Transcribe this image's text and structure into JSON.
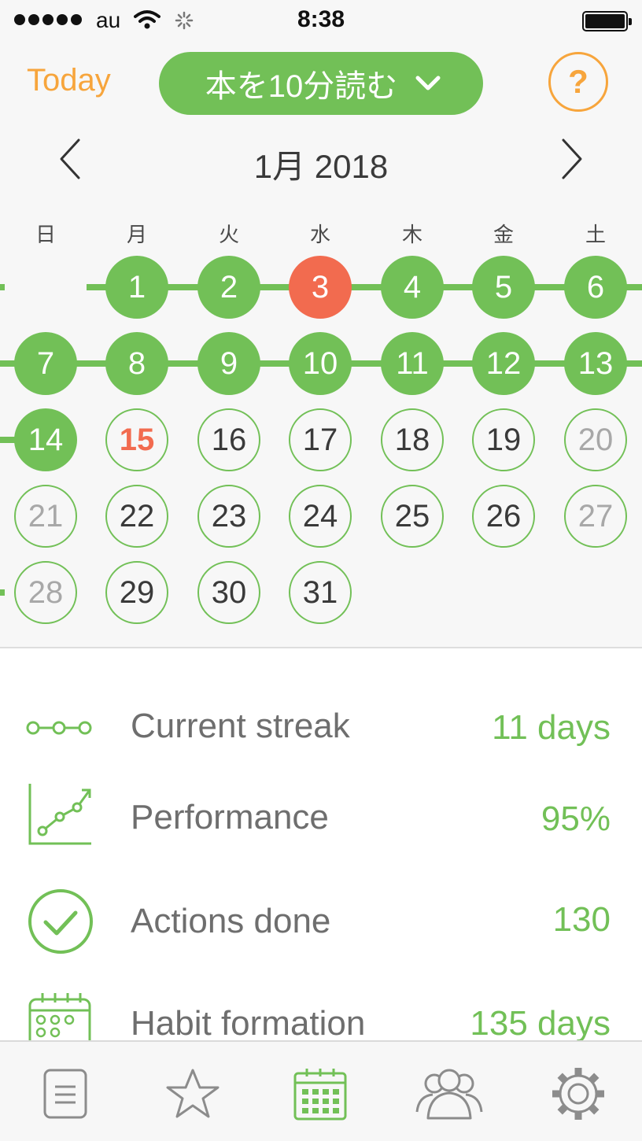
{
  "status_bar": {
    "carrier": "au",
    "time": "8:38"
  },
  "header": {
    "today_label": "Today",
    "habit_title": "本を10分読む",
    "help_label": "?"
  },
  "calendar": {
    "month_label": "1月 2018",
    "weekdays": [
      "日",
      "月",
      "火",
      "水",
      "木",
      "金",
      "土"
    ],
    "days": [
      "1",
      "2",
      "3",
      "4",
      "5",
      "6",
      "7",
      "8",
      "9",
      "10",
      "11",
      "12",
      "13",
      "14",
      "15",
      "16",
      "17",
      "18",
      "19",
      "20",
      "21",
      "22",
      "23",
      "24",
      "25",
      "26",
      "27",
      "28",
      "29",
      "30",
      "31"
    ],
    "missed_days": [
      3
    ],
    "today": 15
  },
  "stats": [
    {
      "label": "Current streak",
      "value": "11 days",
      "icon": "streak-icon"
    },
    {
      "label": "Performance",
      "value": "95%",
      "icon": "performance-chart-icon"
    },
    {
      "label": "Actions done",
      "value": "130",
      "icon": "check-circle-icon"
    },
    {
      "label": "Habit formation",
      "value": "135 days",
      "icon": "calendar-grid-icon"
    }
  ],
  "tabbar": [
    "list-icon",
    "star-icon",
    "calendar-icon",
    "group-icon",
    "gear-icon"
  ],
  "colors": {
    "accent_green": "#72c057",
    "accent_orange": "#f7a53c",
    "missed_red": "#f26b4f"
  }
}
